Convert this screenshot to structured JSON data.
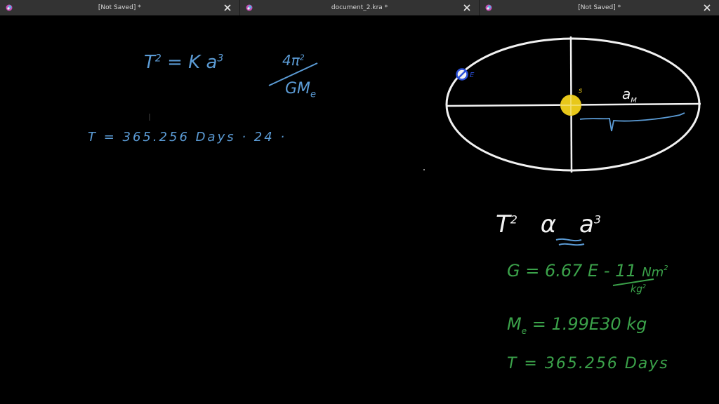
{
  "tabs": [
    {
      "label": "[Not Saved]  *",
      "active": false
    },
    {
      "label": "document_2.kra *",
      "active": false
    },
    {
      "label": "[Not Saved]  *",
      "active": true
    }
  ],
  "colors": {
    "tab_background": "#333333",
    "canvas_background": "#000000",
    "blue_ink": "#5b9bd5",
    "green_ink": "#3ba24a",
    "white_ink": "#f2f2f2",
    "sun_yellow": "#e8c81a"
  },
  "icons": {
    "app": "krita-app-icon",
    "close": "close-x-icon"
  },
  "notes": {
    "eq1_T": "T",
    "eq1_sq": "2",
    "eq1_rest": "= K a",
    "eq1_cube": "3",
    "frac_num": "4π",
    "frac_num_sq": "2",
    "frac_den": "GM",
    "frac_den_sub": "e",
    "period_line": "T = 365.256 Days · 24 ·",
    "orbit_earth_label": "E",
    "orbit_sun_label": "s",
    "orbit_axis_label": "a",
    "orbit_axis_sub": "M",
    "prop_T": "T",
    "prop_sq": "2",
    "prop_symbol": "α",
    "prop_a": "a",
    "prop_cube": "3",
    "G_value": "G = 6.67 E - 11",
    "G_units_num": "Nm",
    "G_units_num_sq": "2",
    "G_units_den": "kg",
    "G_units_den_sq": "2",
    "mass_line": "M",
    "mass_sub": "e",
    "mass_value": "= 1.99E30 kg",
    "period_green": "T = 365.256 Days"
  }
}
